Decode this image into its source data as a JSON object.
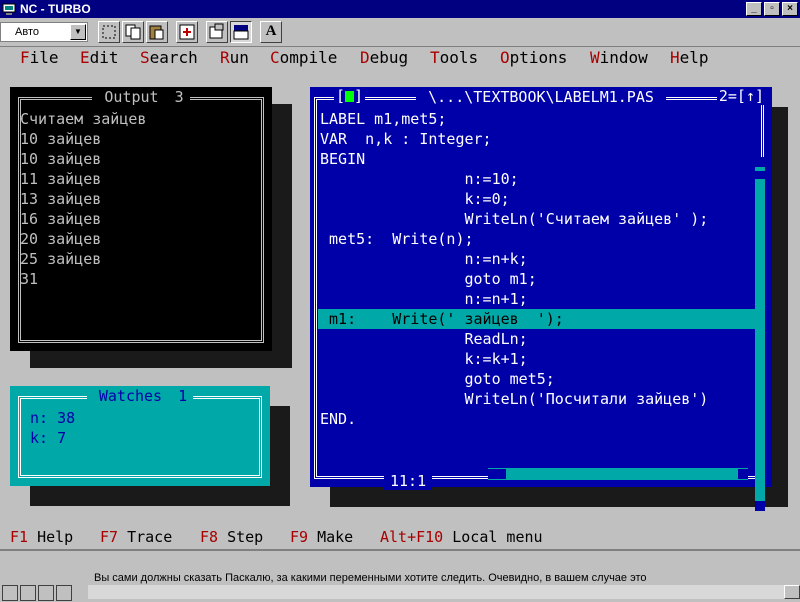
{
  "window": {
    "title": "NC - TURBO"
  },
  "toolbar": {
    "font_select": "Авто",
    "buttons": [
      "select-icon",
      "copy-icon",
      "paste-icon",
      "fullscreen-icon",
      "properties-icon",
      "background-icon",
      "font-icon"
    ],
    "font_button_label": "A"
  },
  "menu": {
    "items": [
      {
        "hotkey": "F",
        "rest": "ile"
      },
      {
        "hotkey": "E",
        "rest": "dit"
      },
      {
        "hotkey": "S",
        "rest": "earch"
      },
      {
        "hotkey": "R",
        "rest": "un"
      },
      {
        "hotkey": "C",
        "rest": "ompile"
      },
      {
        "hotkey": "D",
        "rest": "ebug"
      },
      {
        "hotkey": "T",
        "rest": "ools"
      },
      {
        "hotkey": "O",
        "rest": "ptions"
      },
      {
        "hotkey": "W",
        "rest": "indow"
      },
      {
        "hotkey": "H",
        "rest": "elp"
      }
    ]
  },
  "output_window": {
    "title": "Output",
    "number": "3",
    "lines": [
      "Считаем зайцев",
      "10 зайцев",
      "10 зайцев",
      "11 зайцев",
      "13 зайцев",
      "16 зайцев",
      "20 зайцев",
      "25 зайцев",
      "31"
    ]
  },
  "watches_window": {
    "title": "Watches",
    "number": "1",
    "lines": [
      "n: 38",
      "k: 7"
    ]
  },
  "editor_window": {
    "path": "\\...\\TEXTBOOK\\LABELM1.PAS",
    "number": "2",
    "zoom_glyph": "↑",
    "position": "11:1",
    "highlighted_line": 10,
    "code": [
      "LABEL m1,met5;",
      "VAR  n,k : Integer;",
      "BEGIN",
      "                n:=10;",
      "                k:=0;",
      "                WriteLn('Считаем зайцев' );",
      " met5:  Write(n);",
      "                n:=n+k;",
      "                goto m1;",
      "                n:=n+1;",
      " m1:    Write(' зайцев  ');",
      "                ReadLn;",
      "                k:=k+1;",
      "                goto met5;",
      "                WriteLn('Посчитали зайцев')",
      "END."
    ]
  },
  "status_line": [
    {
      "key": "F1",
      "label": "Help"
    },
    {
      "key": "F7",
      "label": "Trace"
    },
    {
      "key": "F8",
      "label": "Step"
    },
    {
      "key": "F9",
      "label": "Make"
    },
    {
      "key": "Alt+F10",
      "label": "Local menu"
    }
  ],
  "help_bar": {
    "text": "Вы сами должны сказать Паскалю, за какими переменными хотите следить. Очевидно, в вашем случае это"
  }
}
